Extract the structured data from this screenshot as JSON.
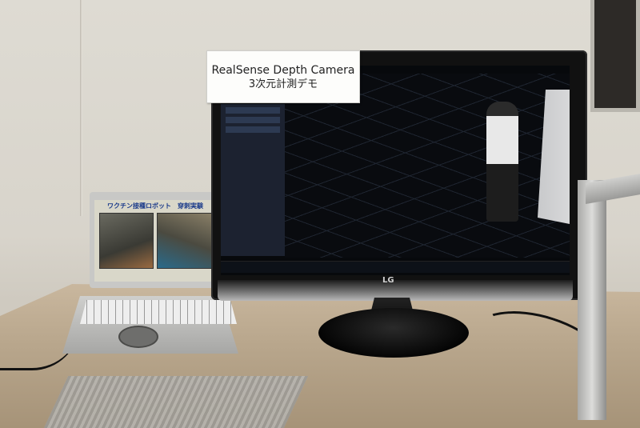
{
  "photo": {
    "sign": {
      "line1": "RealSense Depth Camera",
      "line2": "3次元計測デモ"
    },
    "laptop_screen_title": "ワクチン接種ロボット　穿刺実験",
    "monitor_logo": "LG",
    "colors": {
      "wall": "#dcd9d1",
      "desk": "#b9a78d",
      "laptop_title": "#1a3a8a"
    }
  }
}
